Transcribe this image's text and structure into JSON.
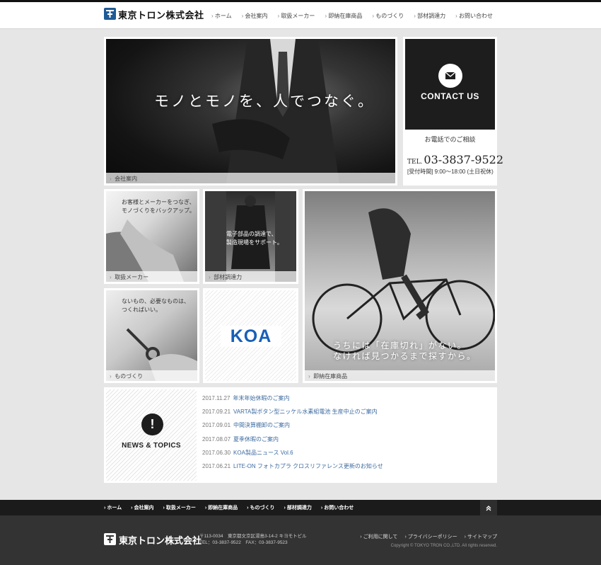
{
  "header": {
    "company_name": "東京トロン株式会社",
    "nav": [
      "ホーム",
      "会社案内",
      "取扱メーカー",
      "即納在庫商品",
      "ものづくり",
      "部材調達力",
      "お問い合わせ"
    ]
  },
  "hero": {
    "headline": "モノとモノを、人でつなぐ。",
    "caption": "会社案内"
  },
  "contact": {
    "title": "CONTACT US",
    "icon": "envelope-icon",
    "consult": "お電話でのご相談",
    "tel_prefix": "TEL.",
    "tel": "03-3837-9522",
    "hours": "[受付時間] 9:00～18:00 (土日祝休)"
  },
  "tiles": {
    "makers": {
      "copy": [
        "お客様とメーカーをつなぎ、",
        "モノづくりをバックアップ。"
      ],
      "caption": "取扱メーカー"
    },
    "procurement": {
      "copy": [
        "電子部品の調達で、",
        "製造現場をサポート。"
      ],
      "caption": "部材調達力"
    },
    "stock": {
      "copy": [
        "うちには「在庫切れ」がない。",
        "なければ見つかるまで探すから。"
      ],
      "caption": "即納在庫商品"
    },
    "monozukuri": {
      "copy": [
        "ないもの、必要なものは、",
        "つくればいい。"
      ],
      "caption": "ものづくり"
    },
    "koa": {
      "logo_text": "KOA",
      "brand_color": "#1760b8"
    }
  },
  "news": {
    "title": "NEWS & TOPICS",
    "items": [
      {
        "date": "2017.11.27",
        "title": "年末年始休暇のご案内"
      },
      {
        "date": "2017.09.21",
        "title": "VARTA製ボタン型ニッケル水素組電池 生産中止のご案内"
      },
      {
        "date": "2017.09.01",
        "title": "中間決算棚卸のご案内"
      },
      {
        "date": "2017.08.07",
        "title": "夏季休暇のご案内"
      },
      {
        "date": "2017.06.30",
        "title": "KOA製品ニュース Vol.6"
      },
      {
        "date": "2017.06.21",
        "title": "LITE-ON フォトカプラ クロスリファレンス更新のお知らせ"
      }
    ]
  },
  "footer": {
    "nav": [
      "ホーム",
      "会社案内",
      "取扱メーカー",
      "即納在庫商品",
      "ものづくり",
      "部材調達力",
      "お問い合わせ"
    ],
    "company_name": "東京トロン株式会社",
    "address": "〒113-0034　東京都文京区湯島3-14-2 キヨモトビル",
    "phone_fax": "TEL：03-3837-9522　FAX：03-3837-9523",
    "links": [
      "ご利用に関して",
      "プライバシーポリシー",
      "サイトマップ"
    ],
    "copyright": "Copyright © TOKYO TRON CO.,LTD. All rights reserved."
  },
  "colors": {
    "link": "#3d6ba0",
    "dark_panel": "#1d1d1d",
    "footer": "#333333",
    "koa_blue": "#1760b8"
  }
}
